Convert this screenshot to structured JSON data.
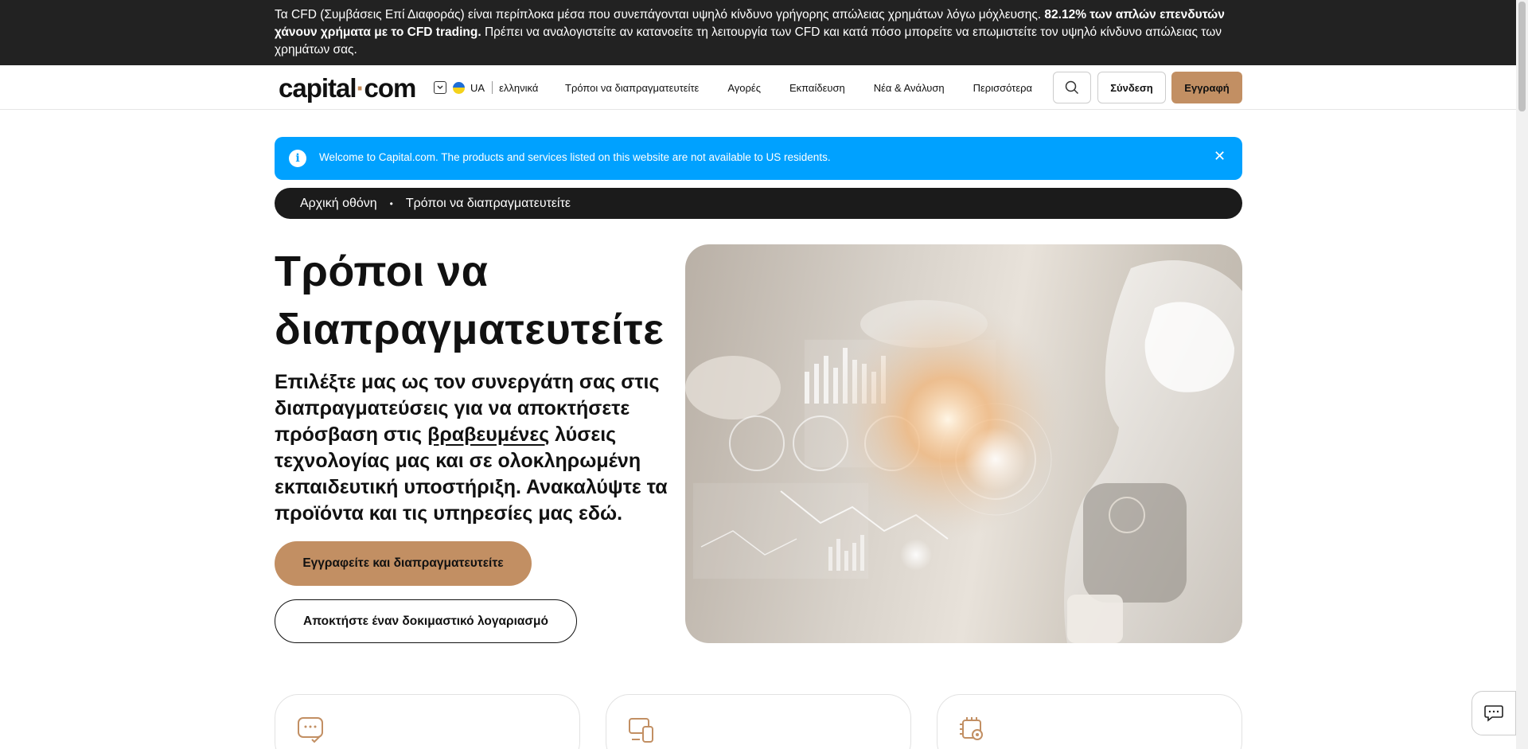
{
  "risk_banner": {
    "text_before": "Τα CFD (Συμβάσεις Επί Διαφοράς) είναι περίπλοκα μέσα που συνεπάγονται υψηλό κίνδυνο γρήγορης απώλειας χρημάτων λόγω μόχλευσης. ",
    "text_bold": "82.12% των απλών επενδυτών χάνουν χρήματα με το CFD trading.",
    "text_after": " Πρέπει να αναλογιστείτε αν κατανοείτε τη λειτουργία των CFD και κατά πόσο μπορείτε να επωμιστείτε τον υψηλό κίνδυνο απώλειας των χρημάτων σας."
  },
  "header": {
    "logo_left": "capital",
    "logo_dot": "·",
    "logo_right": "com",
    "lang_code": "UA",
    "lang_name": "ελληνικά",
    "nav": [
      "Τρόποι να διαπραγματευτείτε",
      "Αγορές",
      "Εκπαίδευση",
      "Νέα & Ανάλυση",
      "Περισσότερα"
    ],
    "login_label": "Σύνδεση",
    "signup_label": "Εγγραφή"
  },
  "notice": {
    "icon": "info-icon",
    "text": "Welcome to Capital.com. The products and services listed on this website are not available to US residents.",
    "close": "✕"
  },
  "breadcrumb": {
    "home": "Αρχική οθόνη",
    "separator": "•",
    "current": "Τρόποι να διαπραγματευτείτε"
  },
  "hero": {
    "title": "Τρόποι να διαπραγματευτείτε",
    "sub_before": "Επιλέξτε μας ως τον συνεργάτη σας στις διαπραγματεύσεις για να αποκτήσετε πρόσβαση στις ",
    "sub_link": "βραβευμένες",
    "sub_after": " λύσεις τεχνολογίας μας και σε ολοκληρωμένη εκπαιδευτική υποστήριξη. Ανακαλύψτε τα προϊόντα και τις υπηρεσίες μας εδώ.",
    "cta_primary": "Εγγραφείτε και διαπραγματευτείτε",
    "cta_secondary": "Αποκτήστε έναν δοκιμαστικό λογαριασμό"
  },
  "cards": [
    {
      "icon": "chat-check-icon"
    },
    {
      "icon": "devices-icon"
    },
    {
      "icon": "chip-gear-icon"
    }
  ],
  "colors": {
    "accent": "#c28f63",
    "notice": "#00a1ff",
    "banner": "#222222"
  }
}
